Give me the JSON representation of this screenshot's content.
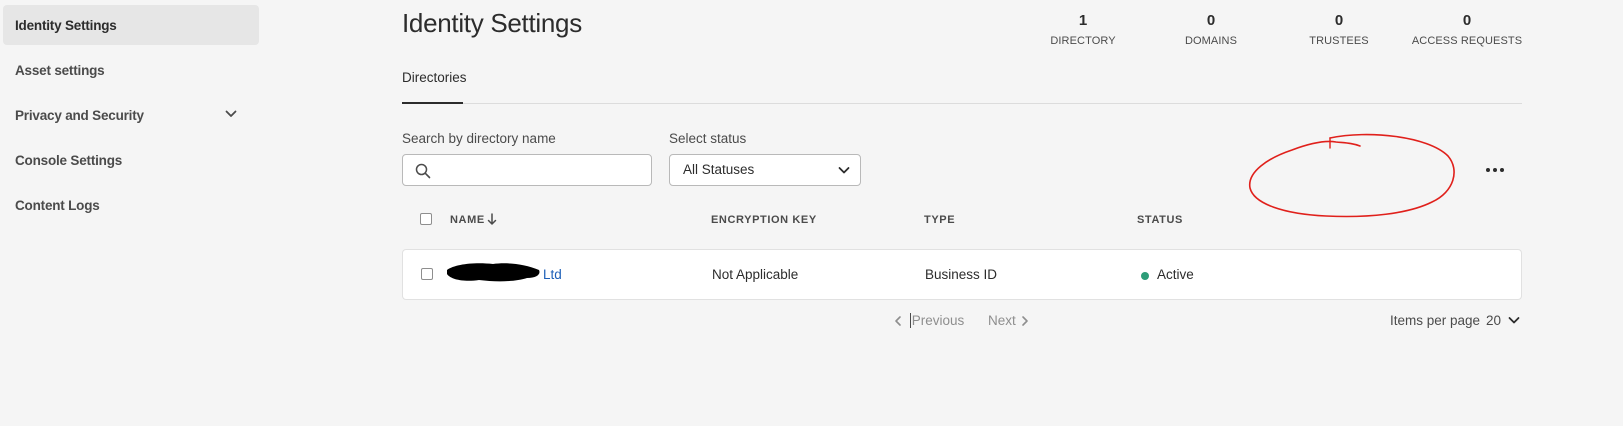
{
  "sidebar": {
    "items": [
      {
        "label": "Identity Settings",
        "active": true
      },
      {
        "label": "Asset settings"
      },
      {
        "label": "Privacy and Security",
        "expandable": true
      },
      {
        "label": "Console Settings"
      },
      {
        "label": "Content Logs"
      }
    ]
  },
  "header": {
    "title": "Identity Settings",
    "stats": [
      {
        "value": "1",
        "label": "DIRECTORY"
      },
      {
        "value": "0",
        "label": "DOMAINS"
      },
      {
        "value": "0",
        "label": "TRUSTEES"
      },
      {
        "value": "0",
        "label": "ACCESS REQUESTS"
      }
    ]
  },
  "tabs": [
    {
      "label": "Directories",
      "selected": true
    }
  ],
  "filters": {
    "search_label": "Search by directory name",
    "search_value": "",
    "status_label": "Select status",
    "status_value": "All Statuses"
  },
  "table": {
    "columns": [
      "NAME",
      "ENCRYPTION KEY",
      "TYPE",
      "STATUS"
    ],
    "rows": [
      {
        "name_suffix": "Ltd",
        "encryption_key": "Not Applicable",
        "type": "Business ID",
        "status": "Active"
      }
    ]
  },
  "pagination": {
    "previous": "Previous",
    "next": "Next",
    "items_per_page_label": "Items per page",
    "items_per_page_value": "20"
  },
  "colors": {
    "background": "#f5f5f5",
    "active_status": "#2d9d78",
    "link": "#1d5fb8",
    "annotation": "#e0201b"
  },
  "icons": {
    "search": "search-icon",
    "sort": "arrow-down-icon",
    "more": "more-horizontal-icon",
    "expand": "chevron-down-icon"
  }
}
